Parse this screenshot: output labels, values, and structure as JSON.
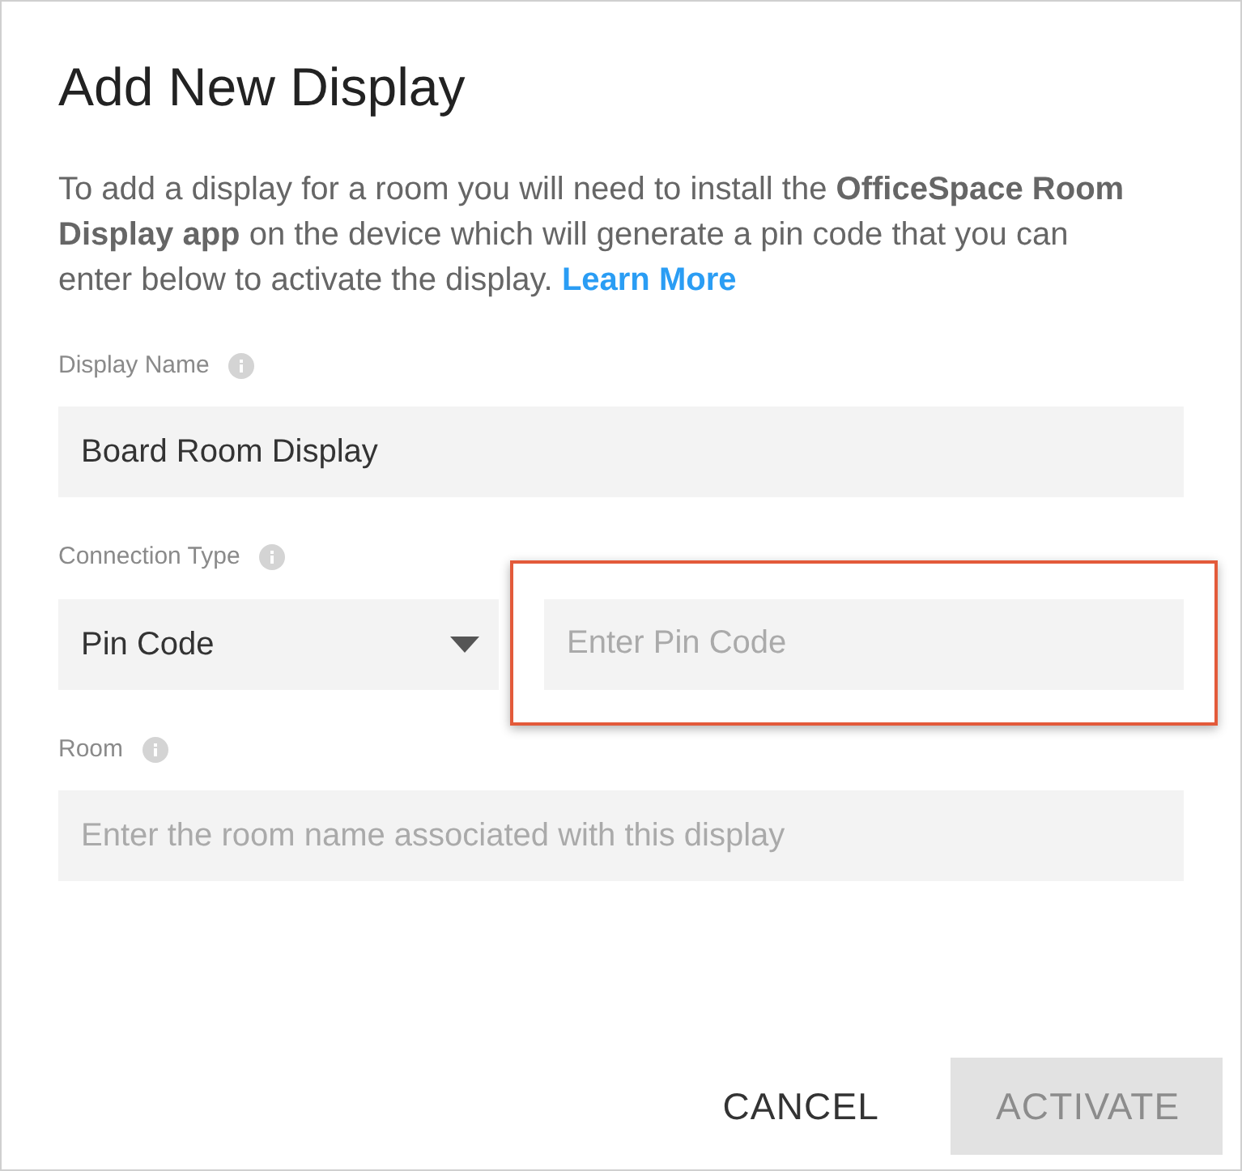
{
  "dialog": {
    "title": "Add New Display",
    "intro": "To add a display for a room you will need to install the **OfficeSpace Room Display app** on the device which will generate a pin code that you can enter below to activate the display.",
    "intro_link": "Learn More",
    "fields": [
      {
        "kind": "text",
        "label": "Display Name",
        "value": "Board Room Display"
      },
      {
        "kind": "connection",
        "label": "Connection Type",
        "select_value": "Pin Code",
        "input_placeholder": "Enter Pin Code",
        "highlighted": true
      },
      {
        "kind": "text",
        "label": "Room",
        "placeholder": "Enter the room name associated with this display"
      }
    ],
    "buttons": [
      {
        "label": "CANCEL",
        "kind": "flat",
        "disabled": false
      },
      {
        "label": "ACTIVATE",
        "kind": "raised",
        "disabled": true
      }
    ]
  }
}
